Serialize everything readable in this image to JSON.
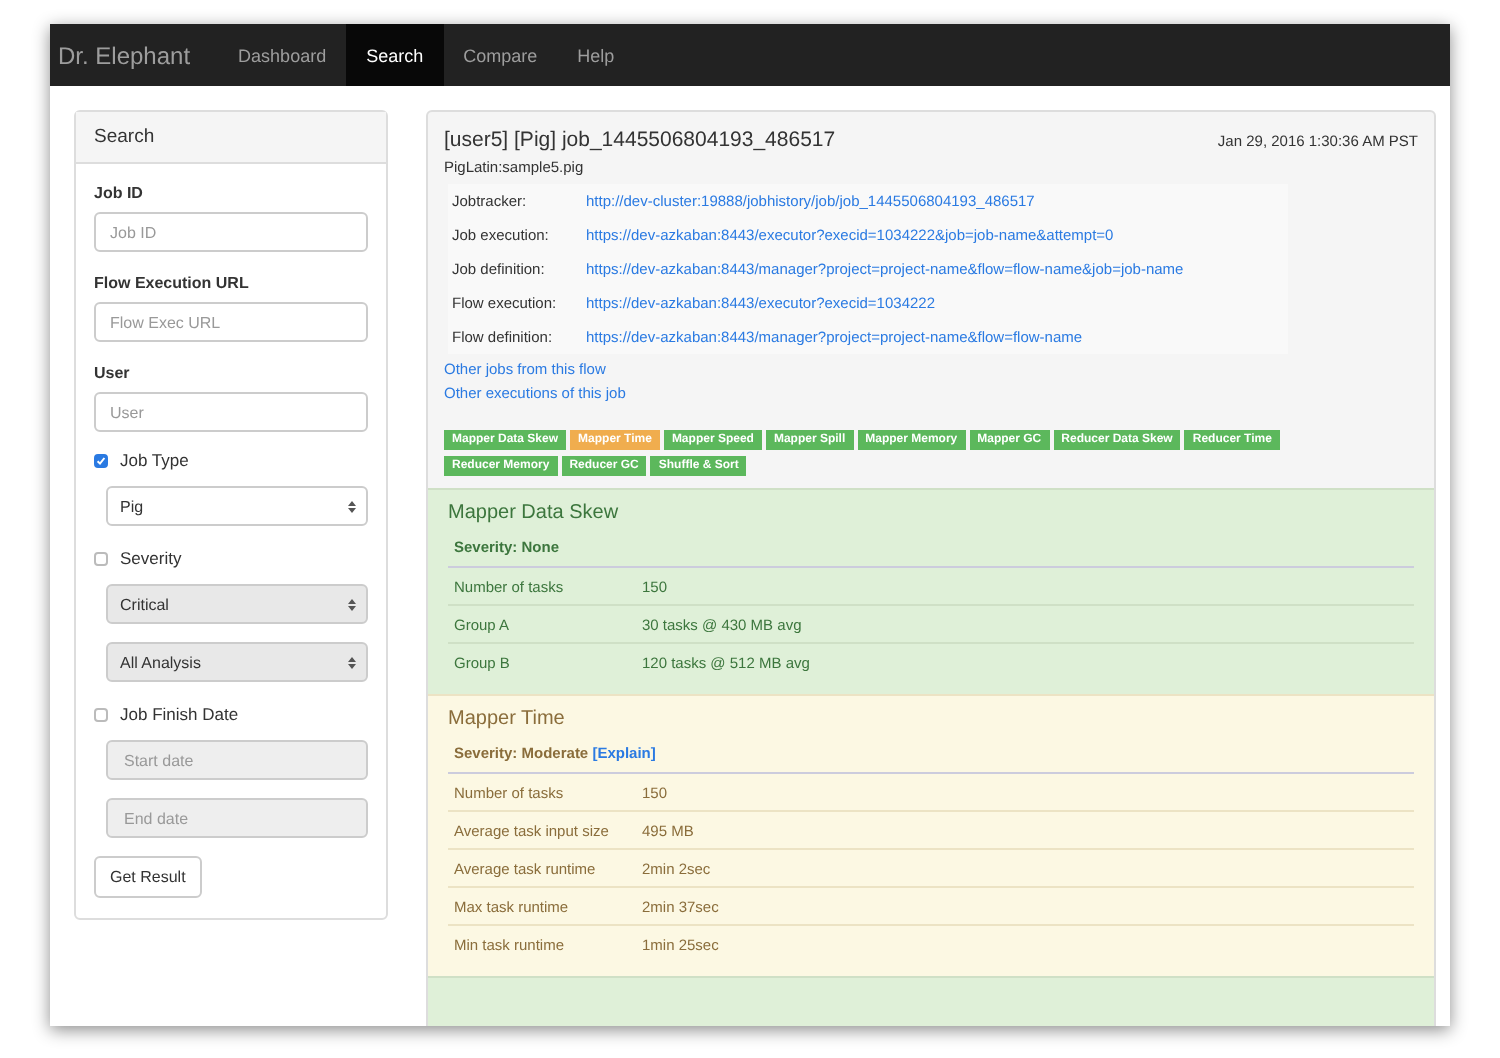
{
  "navbar": {
    "brand": "Dr. Elephant",
    "items": [
      {
        "label": "Dashboard",
        "selected": false
      },
      {
        "label": "Search",
        "selected": true
      },
      {
        "label": "Compare",
        "selected": false
      },
      {
        "label": "Help",
        "selected": false
      }
    ]
  },
  "sidebar": {
    "title": "Search",
    "fields": [
      {
        "kind": "text",
        "label": "Job ID",
        "placeholder": "Job ID"
      },
      {
        "kind": "text",
        "label": "Flow Execution URL",
        "placeholder": "Flow Exec URL"
      },
      {
        "kind": "text",
        "label": "User",
        "placeholder": "User"
      },
      {
        "kind": "check",
        "label": "Job Type",
        "checked": true
      },
      {
        "kind": "select",
        "value": "Pig",
        "disabled": false
      },
      {
        "kind": "check",
        "label": "Severity",
        "checked": false
      },
      {
        "kind": "select",
        "value": "Critical",
        "disabled": true
      },
      {
        "kind": "select",
        "value": "All Analysis",
        "disabled": true
      },
      {
        "kind": "check",
        "label": "Job Finish Date",
        "checked": false
      },
      {
        "kind": "date",
        "placeholder": "Start date",
        "disabled": true
      },
      {
        "kind": "date",
        "placeholder": "End date",
        "disabled": true
      }
    ],
    "button": "Get Result"
  },
  "job": {
    "title": "[user5] [Pig] job_1445506804193_486517",
    "date": "Jan 29, 2016 1:30:36 AM PST",
    "script": "PigLatin:sample5.pig",
    "links": [
      {
        "label": "Jobtracker:",
        "url": "http://dev-cluster:19888/jobhistory/job/job_1445506804193_486517"
      },
      {
        "label": "Job execution:",
        "url": "https://dev-azkaban:8443/executor?execid=1034222&job=job-name&attempt=0"
      },
      {
        "label": "Job definition:",
        "url": "https://dev-azkaban:8443/manager?project=project-name&flow=flow-name&job=job-name"
      },
      {
        "label": "Flow execution:",
        "url": "https://dev-azkaban:8443/executor?execid=1034222"
      },
      {
        "label": "Flow definition:",
        "url": "https://dev-azkaban:8443/manager?project=project-name&flow=flow-name"
      }
    ],
    "other_links": [
      "Other jobs from this flow",
      "Other executions of this job"
    ],
    "badges": [
      {
        "label": "Mapper Data Skew",
        "kind": "none"
      },
      {
        "label": "Mapper Time",
        "kind": "moderate"
      },
      {
        "label": "Mapper Speed",
        "kind": "none"
      },
      {
        "label": "Mapper Spill",
        "kind": "none"
      },
      {
        "label": "Mapper Memory",
        "kind": "none"
      },
      {
        "label": "Mapper GC",
        "kind": "none"
      },
      {
        "label": "Reducer Data Skew",
        "kind": "none"
      },
      {
        "label": "Reducer Time",
        "kind": "none"
      },
      {
        "label": "Reducer Memory",
        "kind": "none"
      },
      {
        "label": "Reducer GC",
        "kind": "none"
      },
      {
        "label": "Shuffle & Sort",
        "kind": "none"
      }
    ]
  },
  "sections": [
    {
      "title": "Mapper Data Skew",
      "kind": "none",
      "severity_text": "Severity: None",
      "rows": [
        {
          "name": "Number of tasks",
          "value": "150"
        },
        {
          "name": "Group A",
          "value": "30 tasks @ 430 MB avg"
        },
        {
          "name": "Group B",
          "value": "120 tasks @ 512 MB avg"
        }
      ]
    },
    {
      "title": "Mapper Time",
      "kind": "moderate",
      "severity_text": "Severity: Moderate",
      "explain": "[Explain]",
      "rows": [
        {
          "name": "Number of tasks",
          "value": "150"
        },
        {
          "name": "Average task input size",
          "value": "495 MB"
        },
        {
          "name": "Average task runtime",
          "value": "2min 2sec"
        },
        {
          "name": "Max task runtime",
          "value": "2min 37sec"
        },
        {
          "name": "Min task runtime",
          "value": "1min 25sec"
        }
      ]
    },
    {
      "kind": "none"
    }
  ]
}
